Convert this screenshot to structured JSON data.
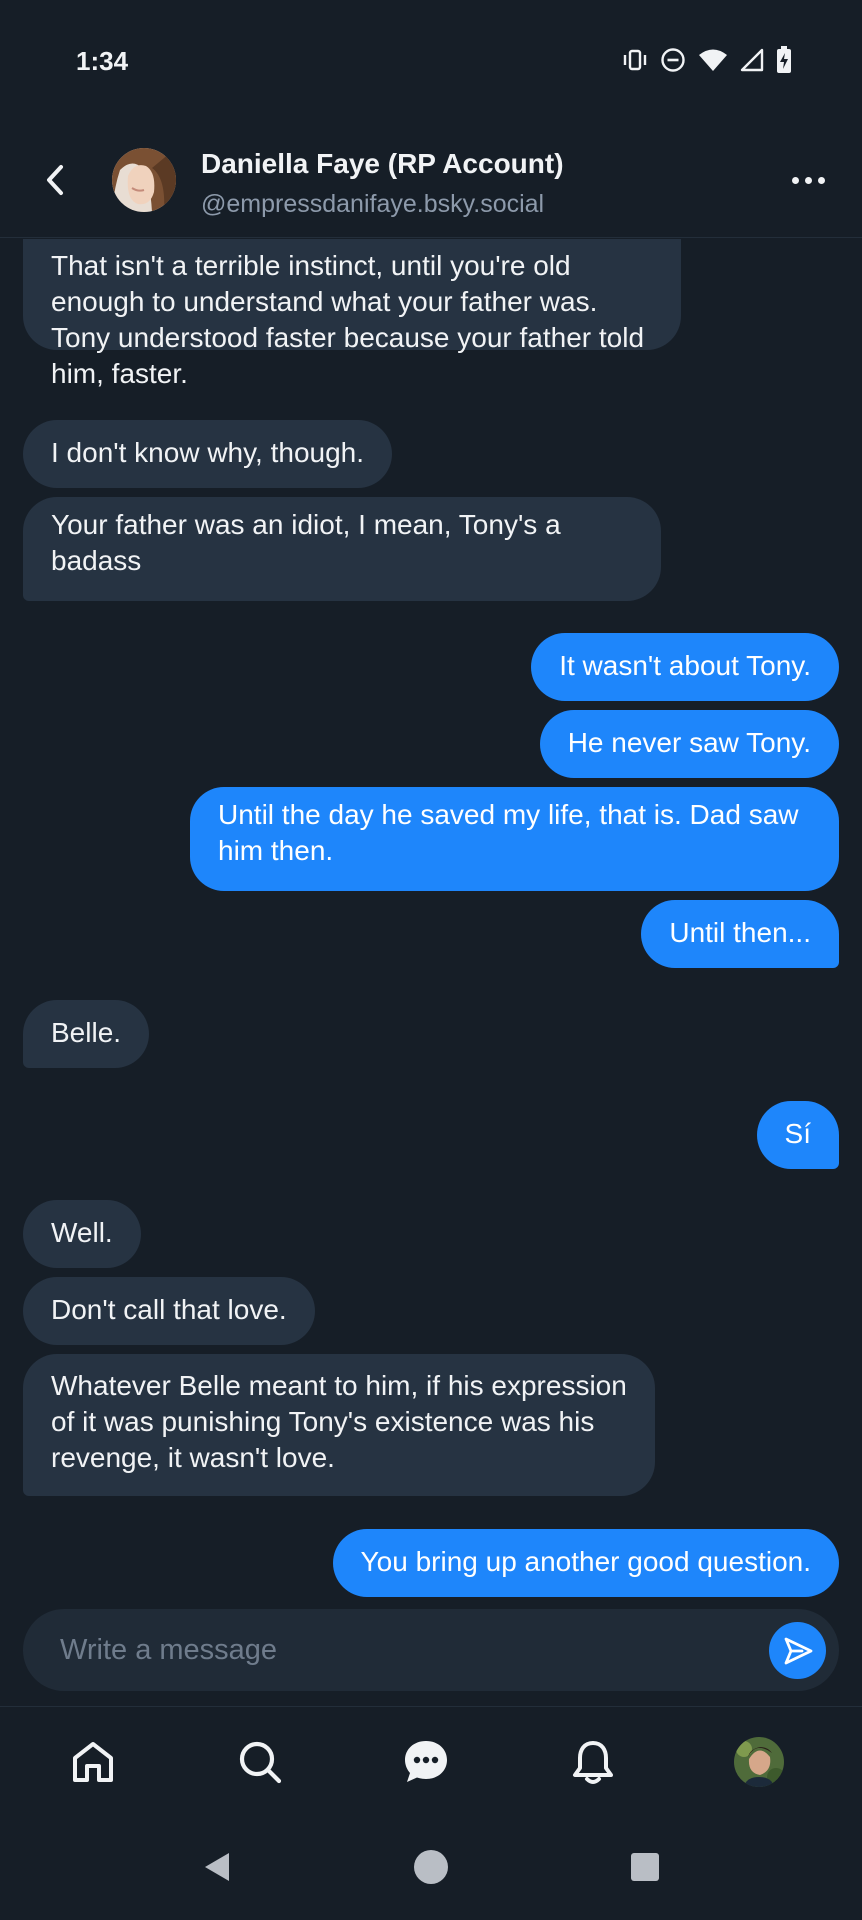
{
  "status_bar": {
    "time": "1:34",
    "icons": [
      "vibrate-icon",
      "do-not-disturb-icon",
      "wifi-icon",
      "cell-signal-icon",
      "battery-charging-icon"
    ]
  },
  "header": {
    "name": "Daniella Faye (RP Account)",
    "handle": "@empressdanifaye.bsky.social",
    "back_icon": "chevron-left-icon",
    "more_icon": "more-horizontal-icon"
  },
  "messages": [
    {
      "sender": "them",
      "text": "That isn't a terrible instinct, until you're old enough to understand what your father was. Tony understood faster because your father told him, faster."
    },
    {
      "sender": "them",
      "text": "I don't know why, though."
    },
    {
      "sender": "them",
      "text": "Your father was an idiot, I mean, Tony's a badass"
    },
    {
      "sender": "me",
      "text": "It wasn't about Tony."
    },
    {
      "sender": "me",
      "text": "He never saw Tony."
    },
    {
      "sender": "me",
      "text": "Until the day he saved my life, that is. Dad saw him then."
    },
    {
      "sender": "me",
      "text": "Until then..."
    },
    {
      "sender": "them",
      "text": "Belle."
    },
    {
      "sender": "me",
      "text": "Sí"
    },
    {
      "sender": "them",
      "text": "Well."
    },
    {
      "sender": "them",
      "text": "Don't call that love."
    },
    {
      "sender": "them",
      "text": "Whatever Belle meant to him, if his expression of it was punishing Tony's existence was his revenge, it wasn't love."
    },
    {
      "sender": "me",
      "text": "You bring up another good question."
    }
  ],
  "composer": {
    "placeholder": "Write a message",
    "value": ""
  },
  "bottom_nav": [
    "home-icon",
    "search-icon",
    "chat-icon",
    "bell-icon",
    "profile-avatar"
  ],
  "system_nav": [
    "back-triangle-icon",
    "home-circle-icon",
    "recents-square-icon"
  ],
  "colors": {
    "background": "#161e27",
    "incoming_bubble": "#263342",
    "outgoing_bubble": "#1e86fb",
    "secondary_text": "#8d9aab"
  }
}
